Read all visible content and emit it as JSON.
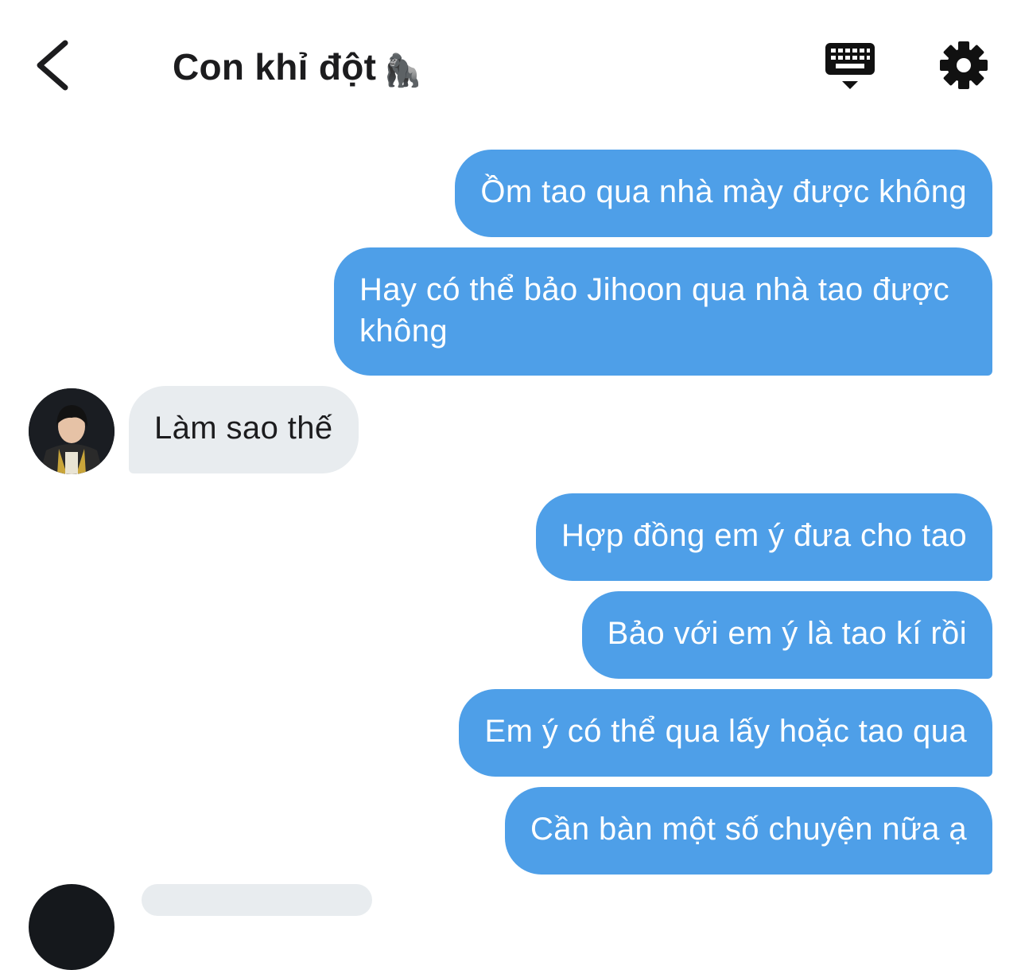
{
  "header": {
    "title": "Con khỉ đột",
    "title_emoji": "🦍",
    "icons": [
      "back-chevron-icon",
      "keyboard-hide-icon",
      "gear-icon"
    ]
  },
  "messages": [
    {
      "side": "out",
      "text": "Ồm tao qua nhà mày được không"
    },
    {
      "side": "out",
      "text": "Hay có thể bảo Jihoon qua nhà tao được không"
    },
    {
      "side": "in",
      "text": "Làm sao thế"
    },
    {
      "side": "out",
      "text": "Hợp đồng em ý đưa cho tao"
    },
    {
      "side": "out",
      "text": "Bảo với em ý là tao kí rồi"
    },
    {
      "side": "out",
      "text": "Em ý có thể qua lấy hoặc tao qua"
    },
    {
      "side": "out",
      "text": "Cần bàn một số chuyện nữa ạ"
    }
  ],
  "colors": {
    "outgoing_bubble": "#4e9fe8",
    "incoming_bubble": "#e8ecef",
    "background": "#ffffff",
    "text_dark": "#1c1c1e"
  }
}
